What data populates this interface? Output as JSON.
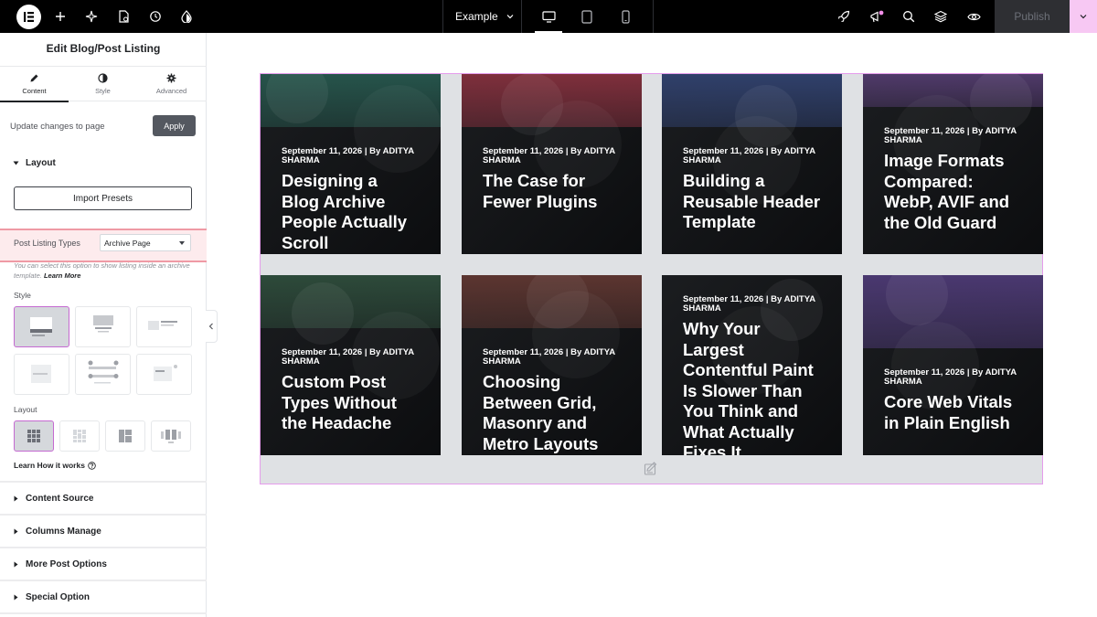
{
  "toolbar": {
    "site_name": "Example",
    "publish_label": "Publish",
    "icons": [
      "elementor-logo-icon",
      "add-icon",
      "ai-sparkle-icon",
      "page-settings-icon",
      "history-icon",
      "site-settings-icon",
      "device-desktop-icon",
      "device-tablet-icon",
      "device-mobile-icon",
      "rocket-icon",
      "notifications-icon",
      "search-icon",
      "structure-layers-icon",
      "preview-eye-icon",
      "chevron-down-icon"
    ]
  },
  "colors": {
    "accent_pink": "#c56ad1",
    "publish_dropdown": "#f7c8f3",
    "highlight_row": "#fdebed",
    "highlight_border": "#ef9aa5"
  },
  "panel": {
    "title": "Edit Blog/Post Listing",
    "tabs": [
      {
        "label": "Content",
        "icon": "pencil-icon",
        "active": true
      },
      {
        "label": "Style",
        "icon": "half-circle-icon",
        "active": false
      },
      {
        "label": "Advanced",
        "icon": "gear-icon",
        "active": false
      }
    ],
    "update_text": "Update changes to page",
    "apply_label": "Apply",
    "layout_section": {
      "title": "Layout",
      "import_presets_label": "Import Presets",
      "post_listing_types_label": "Post Listing Types",
      "post_listing_types_value": "Archive Page",
      "help_text": "You can select this option to show listing inside an archive template.",
      "help_link": "Learn More",
      "style_label": "Style",
      "style_selected_index": 0,
      "layout_label": "Layout",
      "layout_selected_index": 0,
      "learn_how_label": "Learn How it works"
    },
    "collapsed_sections": [
      "Content Source",
      "Columns Manage",
      "More Post Options",
      "Special Option"
    ]
  },
  "posts": [
    {
      "meta": "September 11, 2026 | By ADITYA SHARMA",
      "title": "Designing a Blog Archive People Actually Scroll",
      "color": "#26544b"
    },
    {
      "meta": "September 11, 2026 | By ADITYA SHARMA",
      "title": "The Case for Fewer Plugins",
      "color": "#7f2f3c"
    },
    {
      "meta": "September 11, 2026 | By ADITYA SHARMA",
      "title": "Building a Reusable Header Template",
      "color": "#30406b"
    },
    {
      "meta": "September 11, 2026 | By ADITYA SHARMA",
      "title": "Image Formats Compared: WebP, AVIF and the Old Guard",
      "color": "#503a6a"
    },
    {
      "meta": "September 11, 2026 | By ADITYA SHARMA",
      "title": "Custom Post Types Without the Headache",
      "color": "#2d4a3a"
    },
    {
      "meta": "September 11, 2026 | By ADITYA SHARMA",
      "title": "Choosing Between Grid, Masonry and Metro Layouts",
      "color": "#5c3530"
    },
    {
      "meta": "September 11, 2026 | By ADITYA SHARMA",
      "title": "Why Your Largest Contentful Paint Is Slower Than You Think and What Actually Fixes It",
      "color": "#1f2a3a"
    },
    {
      "meta": "September 11, 2026 | By ADITYA SHARMA",
      "title": "Core Web Vitals in Plain English",
      "color": "#4a3870"
    }
  ]
}
